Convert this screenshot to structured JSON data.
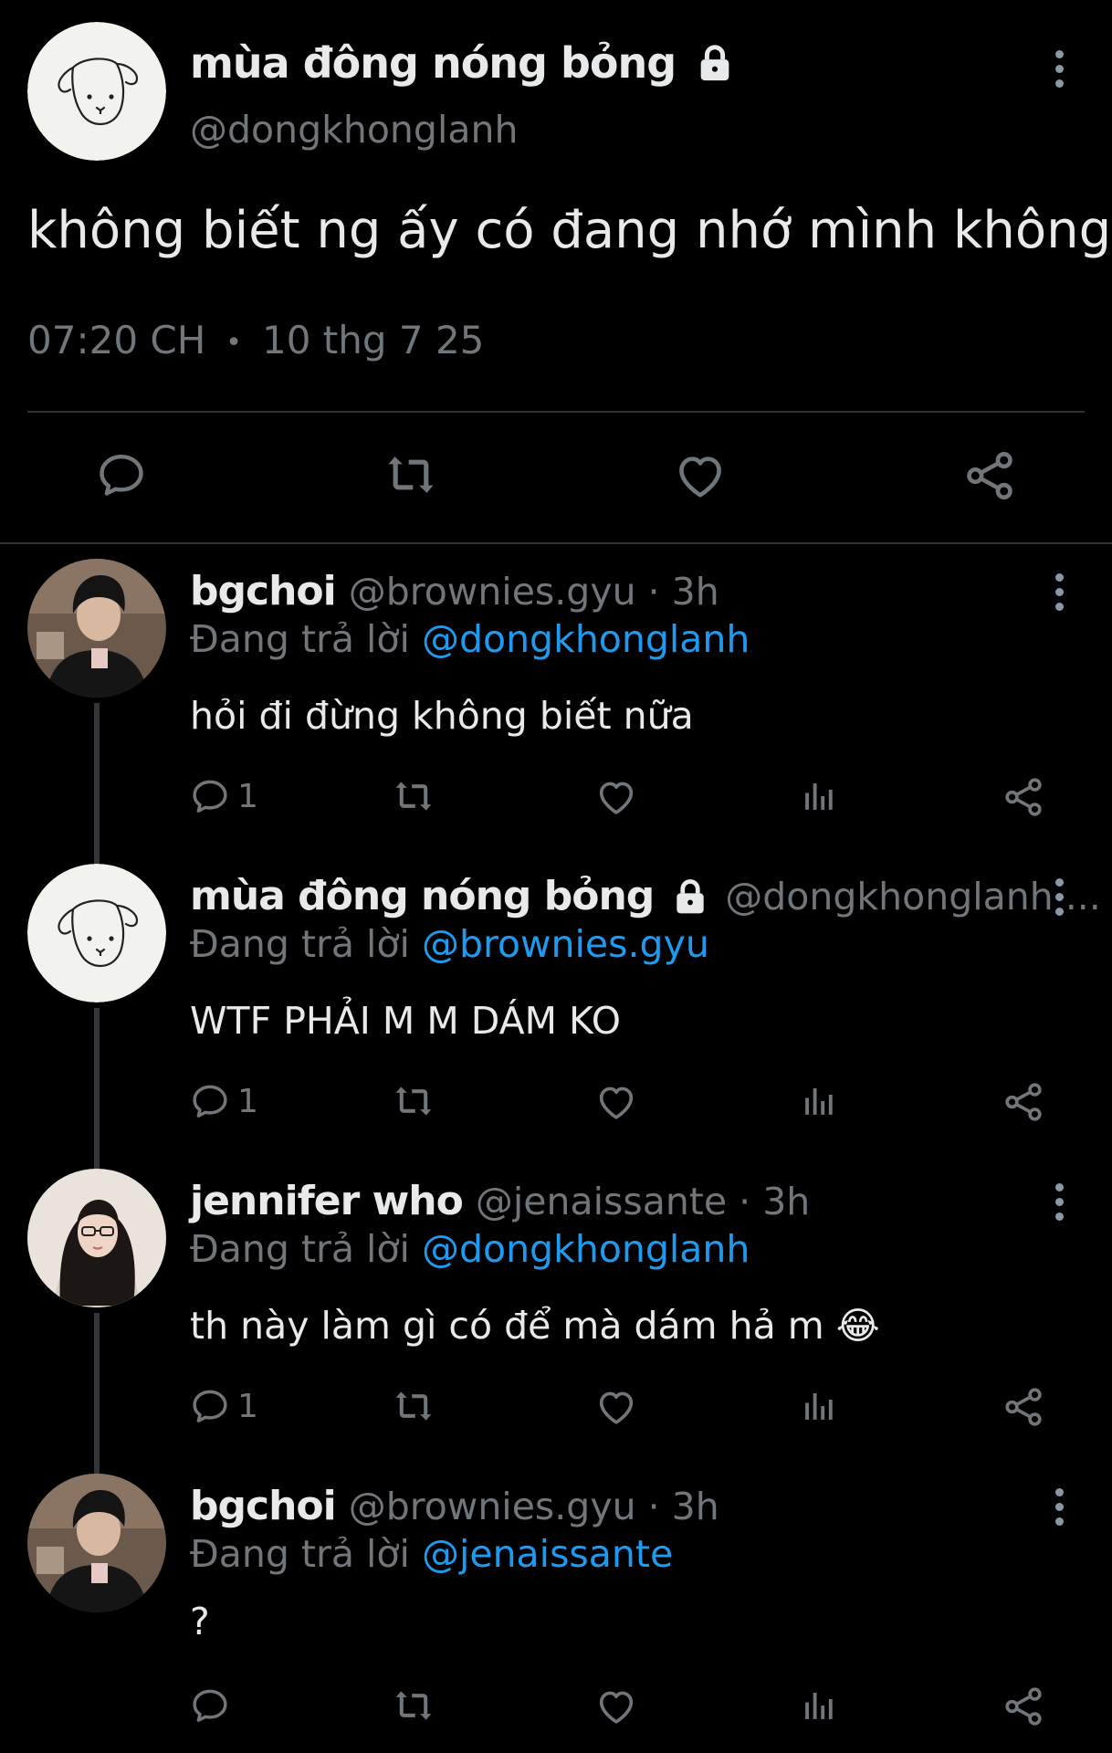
{
  "main_tweet": {
    "display_name": "mùa đông nóng bỏng",
    "handle": "@dongkhonglanh",
    "text": "không biết ng ấy có đang nhớ mình không",
    "time": "07:20 CH",
    "separator": "•",
    "date": "10 thg 7 25"
  },
  "replies": [
    {
      "display_name": "bgchoi",
      "handle_meta": "@brownies.gyu · 3h",
      "replying_prefix": "Đang trả lời",
      "replying_to": "@dongkhonglanh",
      "text": "hỏi đi đừng không biết nữa",
      "reply_count": "1"
    },
    {
      "display_name": "mùa đông nóng bỏng",
      "handle_meta": "@dongkhonglanh ...",
      "replying_prefix": "Đang trả lời",
      "replying_to": "@brownies.gyu",
      "text": "WTF PHẢI M M DÁM KO",
      "reply_count": "1"
    },
    {
      "display_name": "jennifer who",
      "handle_meta": "@jenaissante · 3h",
      "replying_prefix": "Đang trả lời",
      "replying_to": "@dongkhonglanh",
      "text": "th này làm gì có để mà dám hả m 😂",
      "reply_count": "1"
    },
    {
      "display_name": "bgchoi",
      "handle_meta": "@brownies.gyu · 3h",
      "replying_prefix": "Đang trả lời",
      "replying_to": "@jenaissante",
      "text": "?",
      "reply_count": ""
    }
  ],
  "icons": {
    "lock": "lock-icon",
    "more": "more-vertical-icon",
    "reply": "reply-icon",
    "retweet": "retweet-icon",
    "like": "heart-icon",
    "views": "views-icon",
    "share": "share-icon"
  },
  "colors": {
    "background": "#000000",
    "text": "#e7e9ea",
    "secondary": "#71767b",
    "mention": "#1d9bf0",
    "divider": "#2f3336"
  }
}
